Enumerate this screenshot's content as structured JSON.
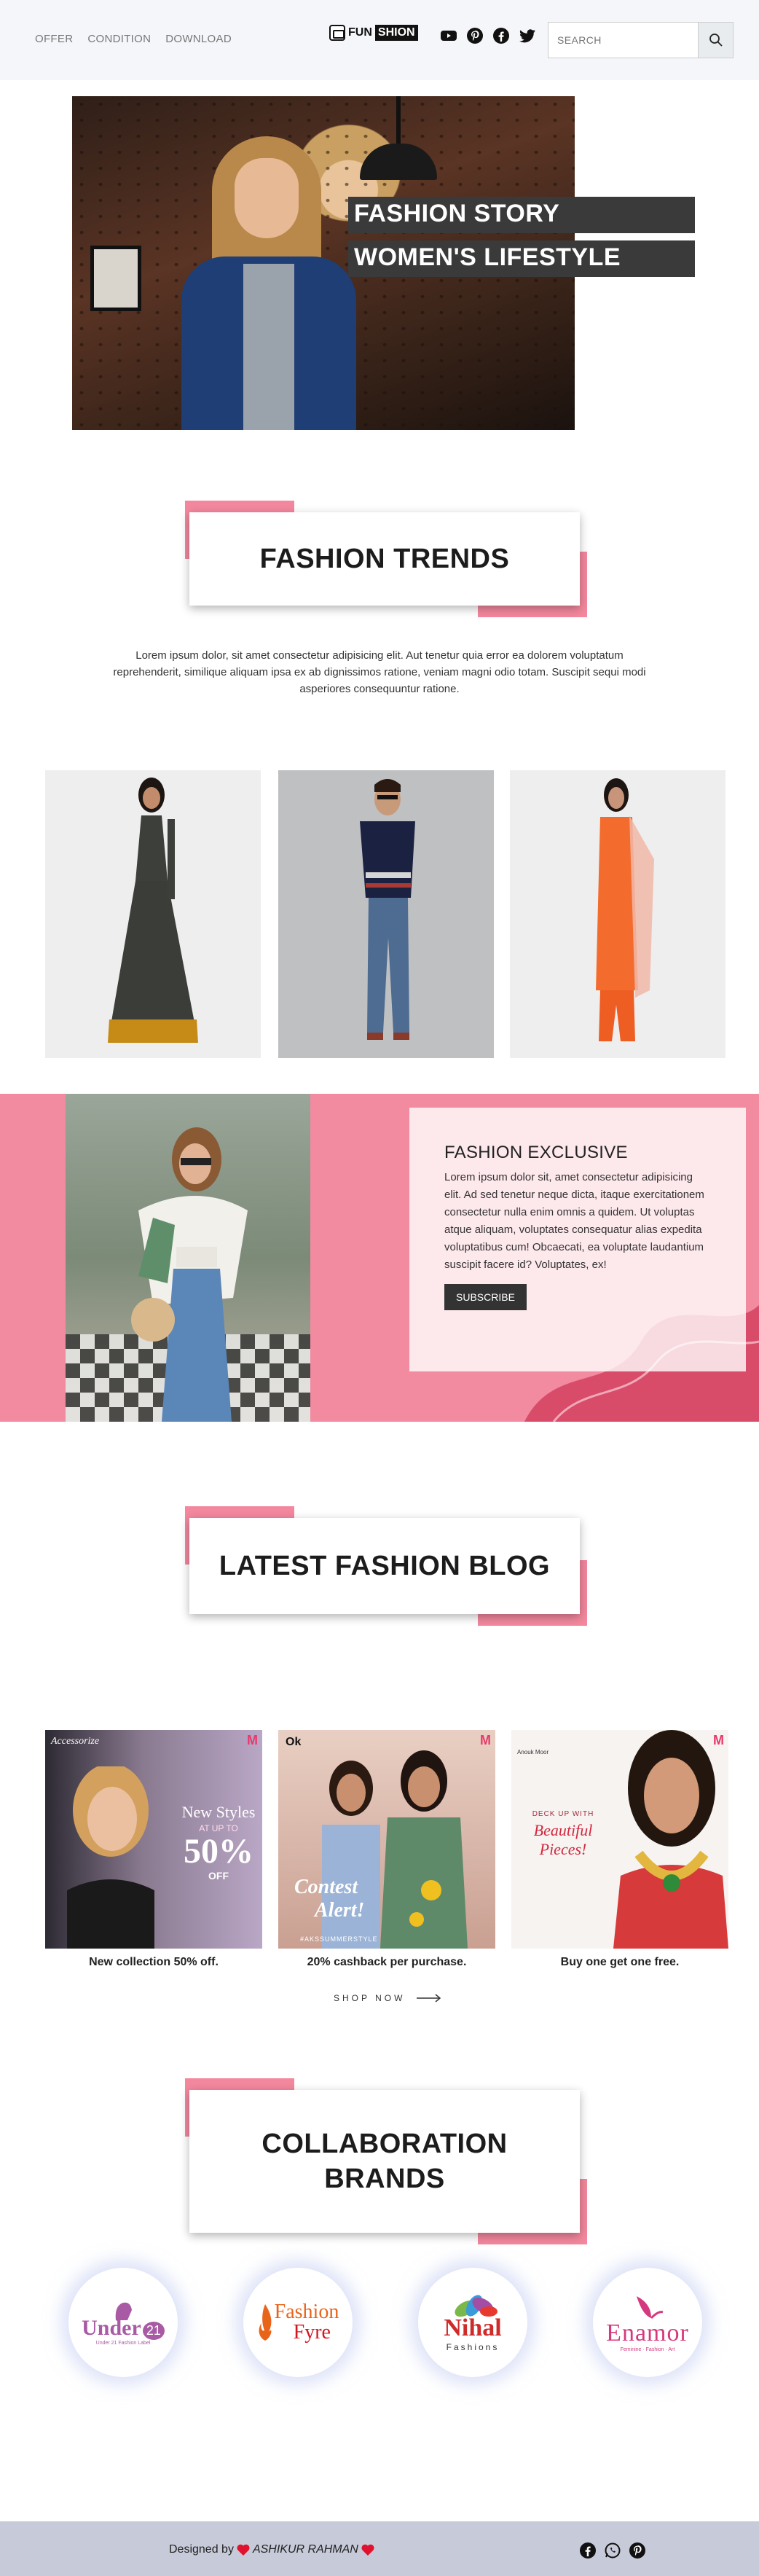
{
  "nav": {
    "items": [
      "OFFER",
      "CONDITION",
      "DOWNLOAD"
    ]
  },
  "logo": {
    "part1": "FUN",
    "part2": "SHION"
  },
  "social_icons": [
    "youtube-icon",
    "pinterest-icon",
    "facebook-icon",
    "twitter-icon"
  ],
  "search": {
    "placeholder": "SEARCH"
  },
  "hero": {
    "line1": "FASHION STORY",
    "line2": "WOMEN'S LIFESTYLE"
  },
  "trends": {
    "title": "FASHION TRENDS",
    "text": "Lorem ipsum dolor, sit amet consectetur adipisicing elit. Aut tenetur quia error ea dolorem voluptatum reprehenderit, similique aliquam ipsa ex ab dignissimos ratione, veniam magni odio totam. Suscipit sequi modi asperiores consequuntur ratione."
  },
  "exclusive": {
    "title": "FASHION EXCLUSIVE",
    "text": "Lorem ipsum dolor sit, amet consectetur adipisicing elit. Ad sed tenetur neque dicta, itaque exercitationem consectetur nulla enim omnis a quidem. Ut voluptas atque aliquam, voluptates consequatur alias expedita voluptatibus cum! Obcaecati, ea voluptate laudantium suscipit facere id? Voluptates, ex!",
    "button": "SUBSCRIBE"
  },
  "blog": {
    "title": "LATEST FASHION BLOG",
    "cards": [
      {
        "brand": "Accessorize",
        "headline": "New Styles",
        "sub": "AT UP TO",
        "big": "50%",
        "off": "OFF",
        "caption": "New collection 50% off."
      },
      {
        "brand": "Ok",
        "headline": "Contest",
        "sub": "Alert!",
        "tag": "#AKSSUMMERSTYLE",
        "caption": "20% cashback per purchase."
      },
      {
        "brand": "Anouk Moor",
        "headline": "DECK UP WITH",
        "sub": "Beautiful Pieces!",
        "caption": "Buy one get one free."
      }
    ],
    "shop_now": "SHOP NOW"
  },
  "brands": {
    "title_line1": "COLLABORATION",
    "title_line2": "BRANDS",
    "items": [
      {
        "name": "Under",
        "tagline": "Under 21 Fashion Label",
        "badge": "21"
      },
      {
        "name_a": "Fashion",
        "name_b": "Fyre"
      },
      {
        "name": "Nihal",
        "tagline": "Fashions"
      },
      {
        "name": "Enamor",
        "tagline": "Feminine · Fashion · Art"
      }
    ]
  },
  "footer": {
    "prefix": "Designed by",
    "author": "ASHIKUR RAHMAN"
  },
  "colors": {
    "accent": "#f28aa0",
    "dark": "#333333",
    "header_bg": "#f5f6fa",
    "footer_bg": "#c7cad8"
  }
}
